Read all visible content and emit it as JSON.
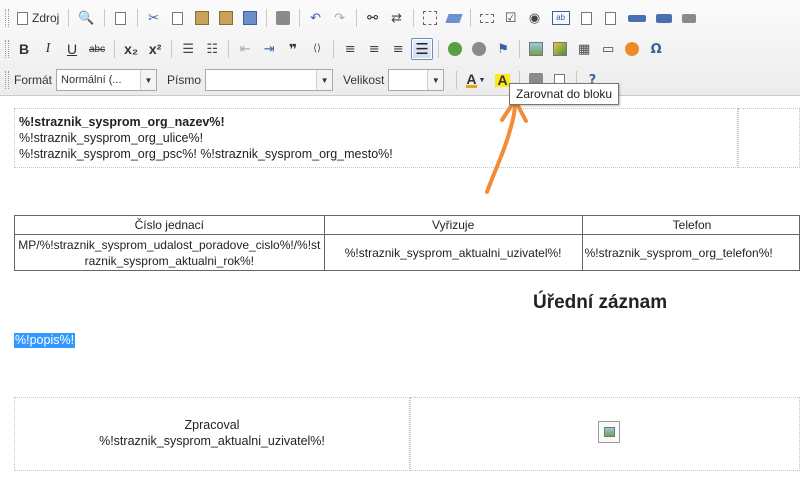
{
  "toolbar": {
    "source_label": "Zdroj",
    "format_label": "Formát",
    "format_value": "Normální (...",
    "font_label": "Písmo",
    "font_value": "",
    "size_label": "Velikost",
    "size_value": "",
    "bold_label": "B",
    "italic_label": "I",
    "underline_label": "U",
    "strike_label": "abc",
    "subscript_label": "x₂",
    "superscript_label": "x²",
    "text_color_label": "A",
    "bg_color_label": "A",
    "quote_label": "❞",
    "tooltip": "Zarovnat do bloku"
  },
  "editor": {
    "address_lines": [
      "%!straznik_sysprom_org_nazev%!",
      "%!straznik_sysprom_org_ulice%!",
      "%!straznik_sysprom_org_psc%! %!straznik_sysprom_org_mesto%!"
    ],
    "ref_table": {
      "headers": [
        "Číslo jednací",
        "Vyřizuje",
        "Telefon"
      ],
      "row": [
        "MP/%!straznik_sysprom_udalost_poradove_cislo%!/%!straznik_sysprom_aktualni_rok%!",
        "%!straznik_sysprom_aktualni_uzivatel%!",
        "%!straznik_sysprom_org_telefon%!"
      ]
    },
    "heading": "Úřední záznam",
    "selected_text": "%!popis%!",
    "signature": {
      "label": "Zpracoval",
      "value": "%!straznik_sysprom_aktualni_uzivatel%!"
    }
  },
  "colors": {
    "selection": "#3399ff",
    "annotation_arrow": "#f28c38",
    "active_button_border": "#6b8fbd"
  }
}
